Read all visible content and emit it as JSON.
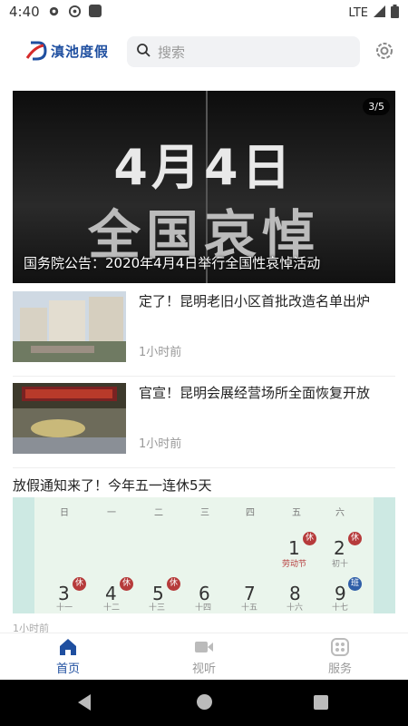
{
  "status": {
    "time": "4:40",
    "network": "LTE"
  },
  "header": {
    "logo_text": "滇池度假",
    "search_placeholder": "搜索"
  },
  "banner": {
    "line1": "4月4日",
    "line2": "全国哀悼",
    "caption": "国务院公告：2020年4月4日举行全国性哀悼活动",
    "pager": "3/5"
  },
  "news": [
    {
      "title": "定了！昆明老旧小区首批改造名单出炉",
      "time": "1小时前"
    },
    {
      "title": "官宣！昆明会展经营场所全面恢复开放",
      "time": "1小时前"
    }
  ],
  "holiday": {
    "title": "放假通知来了！今年五一连休5天",
    "weekdays": [
      "日",
      "一",
      "二",
      "三",
      "四",
      "五",
      "六"
    ],
    "row1": [
      {
        "day": "1",
        "lunar": "劳动节",
        "badge": "休"
      },
      {
        "day": "2",
        "lunar": "初十",
        "badge": "休"
      }
    ],
    "row2": [
      {
        "day": "3",
        "lunar": "十一",
        "badge": "休"
      },
      {
        "day": "4",
        "lunar": "十二",
        "badge": "休"
      },
      {
        "day": "5",
        "lunar": "十三",
        "badge": "休"
      },
      {
        "day": "6",
        "lunar": "十四",
        "badge": ""
      },
      {
        "day": "7",
        "lunar": "十五",
        "badge": ""
      },
      {
        "day": "8",
        "lunar": "十六",
        "badge": ""
      },
      {
        "day": "9",
        "lunar": "十七",
        "badge": "班"
      }
    ],
    "meta_peek": "1小时前"
  },
  "tabs": [
    {
      "label": "首页",
      "icon": "home-icon",
      "active": true
    },
    {
      "label": "视听",
      "icon": "video-icon",
      "active": false
    },
    {
      "label": "服务",
      "icon": "services-icon",
      "active": false
    }
  ],
  "colors": {
    "brand": "#1f4fa0",
    "rest_badge": "#b63b3b",
    "work_badge": "#2f5ea8"
  }
}
